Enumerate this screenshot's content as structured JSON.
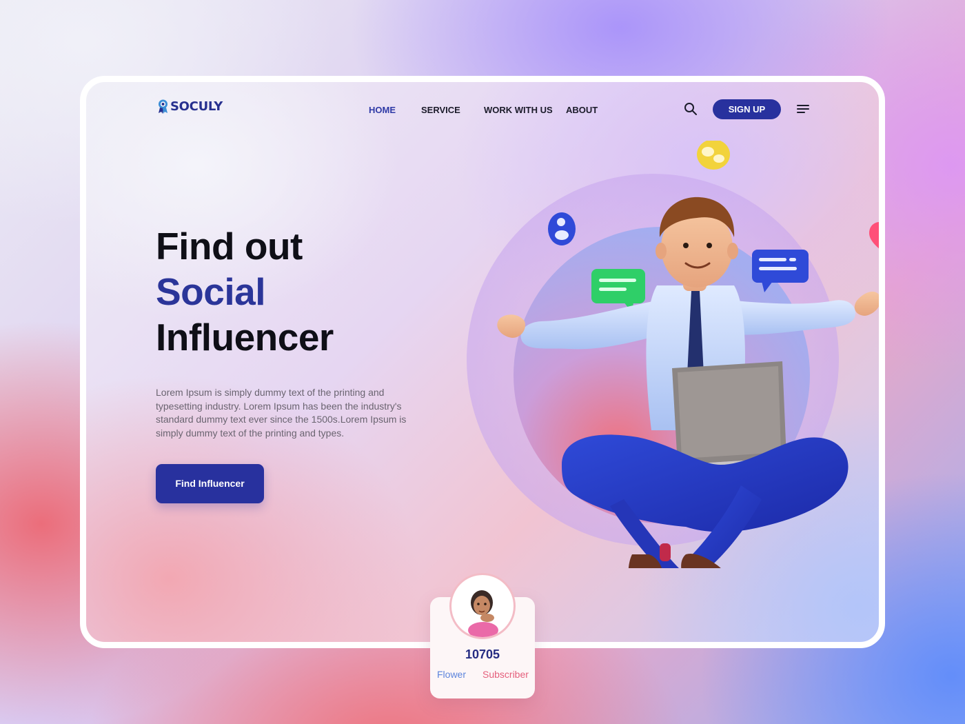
{
  "brand": {
    "name": "SOCULY",
    "logo_icon": "badge-icon"
  },
  "nav": {
    "items": [
      {
        "label": "HOME",
        "active": true
      },
      {
        "label": "SERVICE",
        "active": false
      },
      {
        "label": "WORK WITH US",
        "active": false
      },
      {
        "label": "ABOUT",
        "active": false
      }
    ],
    "search_icon": "search-icon",
    "signup_label": "SIGN UP",
    "menu_icon": "menu-icon"
  },
  "hero": {
    "title_line1": "Find out",
    "title_line2": "Social",
    "title_line3": "Influencer",
    "description": "Lorem Ipsum is simply dummy text of the printing and typesetting industry. Lorem Ipsum has been the industry's standard dummy text ever since the 1500s.Lorem Ipsum is simply dummy text of the printing and types.",
    "cta_label": "Find Influencer"
  },
  "stats": {
    "value": "10705",
    "label_left": "Flower",
    "label_right": "Subscriber"
  },
  "colors": {
    "primary": "#28319e",
    "accent_text": "#2b3599",
    "flower": "#5c84dc",
    "subscriber": "#e55f7c"
  }
}
